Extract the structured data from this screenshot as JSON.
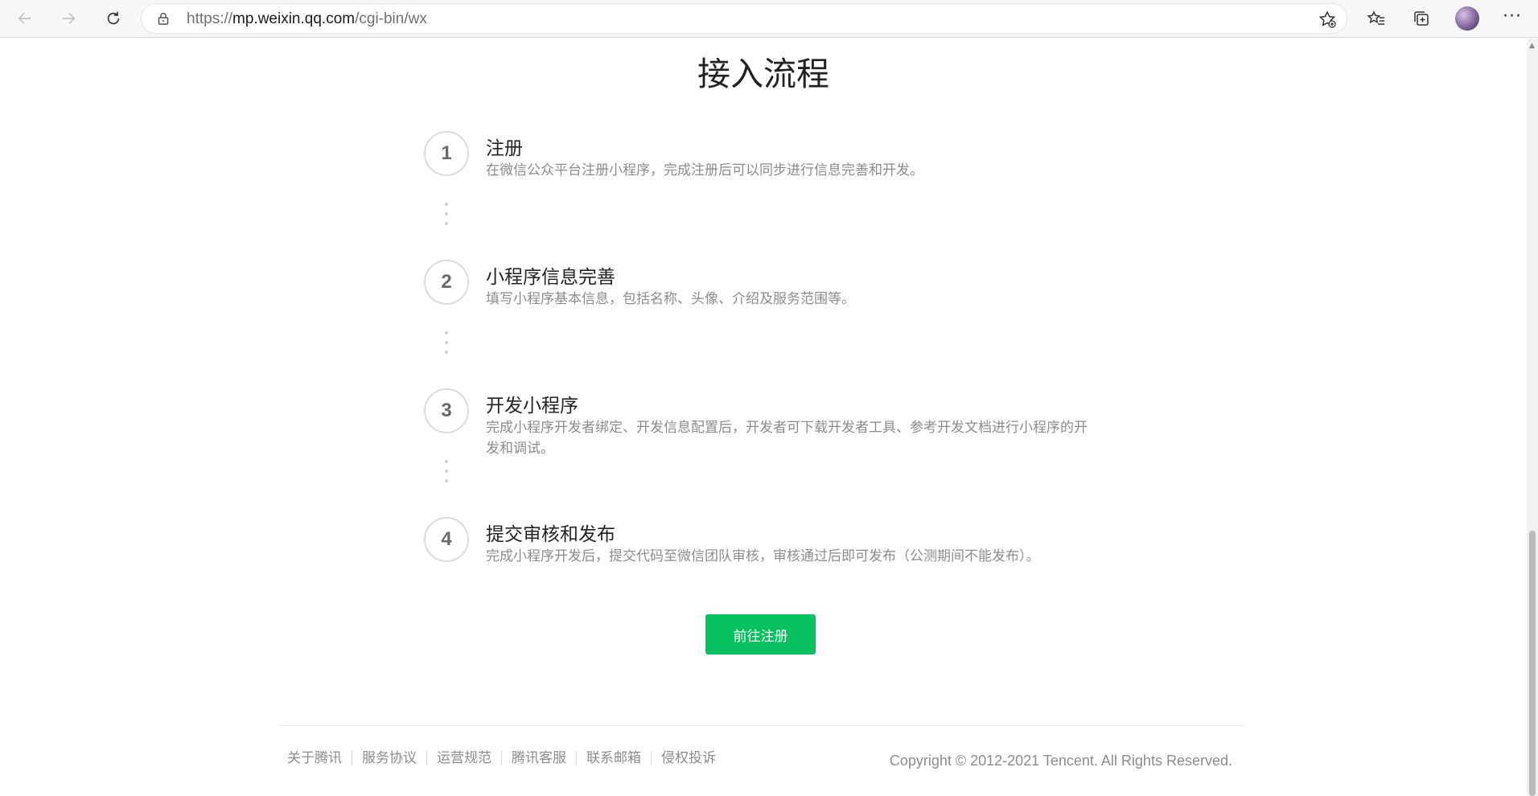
{
  "browser": {
    "url_prefix": "https://",
    "url_host": "mp.weixin.qq.com",
    "url_path": "/cgi-bin/wx",
    "more_label": "···"
  },
  "page": {
    "title": "接入流程",
    "steps": [
      {
        "number": "1",
        "title": "注册",
        "desc": "在微信公众平台注册小程序，完成注册后可以同步进行信息完善和开发。"
      },
      {
        "number": "2",
        "title": "小程序信息完善",
        "desc": "填写小程序基本信息，包括名称、头像、介绍及服务范围等。"
      },
      {
        "number": "3",
        "title": "开发小程序",
        "desc": "完成小程序开发者绑定、开发信息配置后，开发者可下载开发者工具、参考开发文档进行小程序的开发和调试。"
      },
      {
        "number": "4",
        "title": "提交审核和发布",
        "desc": "完成小程序开发后，提交代码至微信团队审核，审核通过后即可发布（公测期间不能发布）。"
      }
    ],
    "cta_label": "前往注册"
  },
  "footer": {
    "links": [
      "关于腾讯",
      "服务协议",
      "运营规范",
      "腾讯客服",
      "联系邮箱",
      "侵权投诉"
    ],
    "copyright": "Copyright © 2012-2021 Tencent. All Rights Reserved."
  },
  "colors": {
    "accent": "#07c160",
    "text_primary": "#222222",
    "text_secondary": "#8c8c8c"
  }
}
